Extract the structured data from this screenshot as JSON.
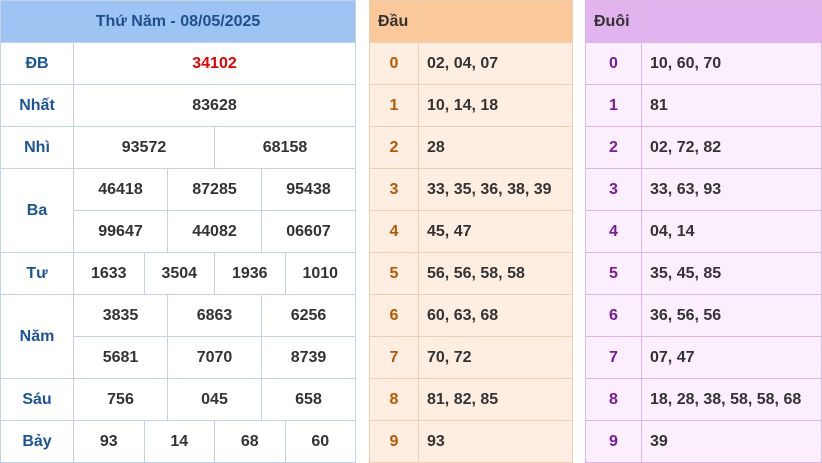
{
  "results": {
    "header": "Thứ Năm - 08/05/2025",
    "prizes": [
      {
        "label": "ĐB",
        "values": [
          "34102"
        ],
        "special": true
      },
      {
        "label": "Nhất",
        "values": [
          "83628"
        ]
      },
      {
        "label": "Nhì",
        "values": [
          "93572",
          "68158"
        ]
      },
      {
        "label": "Ba",
        "values": [
          "46418",
          "87285",
          "95438",
          "99647",
          "44082",
          "06607"
        ]
      },
      {
        "label": "Tư",
        "values": [
          "1633",
          "3504",
          "1936",
          "1010"
        ]
      },
      {
        "label": "Năm",
        "values": [
          "3835",
          "6863",
          "6256",
          "5681",
          "7070",
          "8739"
        ]
      },
      {
        "label": "Sáu",
        "values": [
          "756",
          "045",
          "658"
        ]
      },
      {
        "label": "Bảy",
        "values": [
          "93",
          "14",
          "68",
          "60"
        ]
      }
    ]
  },
  "dau": {
    "header": "Đầu",
    "rows": [
      {
        "key": "0",
        "value": "02, 04, 07"
      },
      {
        "key": "1",
        "value": "10, 14, 18"
      },
      {
        "key": "2",
        "value": "28"
      },
      {
        "key": "3",
        "value": "33, 35, 36, 38, 39"
      },
      {
        "key": "4",
        "value": "45, 47"
      },
      {
        "key": "5",
        "value": "56, 56, 58, 58"
      },
      {
        "key": "6",
        "value": "60, 63, 68"
      },
      {
        "key": "7",
        "value": "70, 72"
      },
      {
        "key": "8",
        "value": "81, 82, 85"
      },
      {
        "key": "9",
        "value": "93"
      }
    ]
  },
  "duoi": {
    "header": "Đuôi",
    "rows": [
      {
        "key": "0",
        "value": "10, 60, 70"
      },
      {
        "key": "1",
        "value": "81"
      },
      {
        "key": "2",
        "value": "02, 72, 82"
      },
      {
        "key": "3",
        "value": "33, 63, 93"
      },
      {
        "key": "4",
        "value": "04, 14"
      },
      {
        "key": "5",
        "value": "35, 45, 85"
      },
      {
        "key": "6",
        "value": "36, 56, 56"
      },
      {
        "key": "7",
        "value": "07, 47"
      },
      {
        "key": "8",
        "value": "18, 28, 38, 58, 58, 68"
      },
      {
        "key": "9",
        "value": "39"
      }
    ]
  },
  "colors": {
    "special_prize": "#e60000",
    "label_text": "#1a5599",
    "results_header_bg": "#9ec4f3",
    "dau_header_bg": "#fbc89a",
    "dau_body_bg": "#fdeee1",
    "duoi_header_bg": "#e2b3ee",
    "duoi_body_bg": "#fbeefd"
  }
}
